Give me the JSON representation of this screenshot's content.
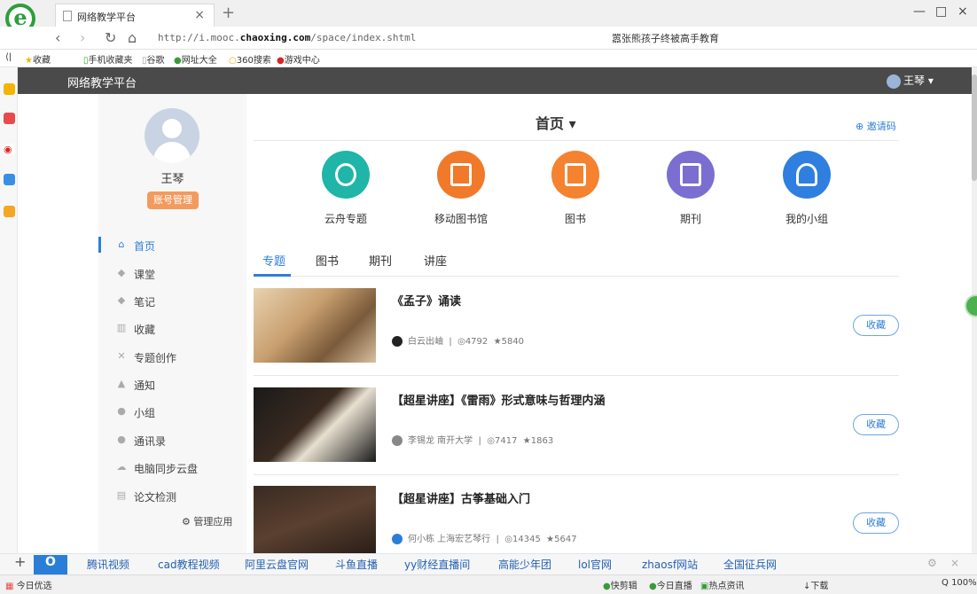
{
  "browser": {
    "tab_title": "网络教学平台",
    "tab_close": "×",
    "new_tab": "+",
    "url_prefix": "http://i.mooc.",
    "url_domain": "chaoxing.com",
    "url_path": "/space/index.shtml",
    "search_text": "嚣张熊孩子终被高手教育",
    "bookmarks": [
      "收藏",
      "手机收藏夹",
      "谷歌",
      "网址大全",
      "360搜索",
      "游戏中心"
    ],
    "win_controls": [
      "—",
      "□",
      "×"
    ]
  },
  "site": {
    "title": "网络教学平台",
    "user_name": "王琴",
    "page_title": "首页 ▾",
    "invite": "邀请码"
  },
  "profile": {
    "name": "王琴",
    "account_button": "账号管理"
  },
  "nav": [
    {
      "label": "首页",
      "icon": "home-icon",
      "glyph": "⌂"
    },
    {
      "label": "课堂",
      "icon": "classroom-icon",
      "glyph": "◆"
    },
    {
      "label": "笔记",
      "icon": "notes-icon",
      "glyph": "◆"
    },
    {
      "label": "收藏",
      "icon": "favorites-icon",
      "glyph": "▥"
    },
    {
      "label": "专题创作",
      "icon": "topic-create-icon",
      "glyph": "✕"
    },
    {
      "label": "通知",
      "icon": "bell-icon",
      "glyph": "▲"
    },
    {
      "label": "小组",
      "icon": "group-icon",
      "glyph": "●"
    },
    {
      "label": "通讯录",
      "icon": "contacts-icon",
      "glyph": "●"
    },
    {
      "label": "电脑同步云盘",
      "icon": "cloud-icon",
      "glyph": "☁"
    },
    {
      "label": "论文检测",
      "icon": "document-check-icon",
      "glyph": "▤"
    }
  ],
  "manage_apps": "管理应用",
  "features": [
    {
      "label": "云舟专题",
      "color": "#1fb5a8"
    },
    {
      "label": "移动图书馆",
      "color": "#f07a2a"
    },
    {
      "label": "图书",
      "color": "#f5822e"
    },
    {
      "label": "期刊",
      "color": "#7a6fd0"
    },
    {
      "label": "我的小组",
      "color": "#2f7fe0"
    }
  ],
  "tabs": [
    "专题",
    "图书",
    "期刊",
    "讲座"
  ],
  "cards": [
    {
      "title": "《孟子》诵读",
      "author": "白云出岫",
      "views": "4792",
      "stars": "5840",
      "fav": "收藏"
    },
    {
      "title": "【超星讲座】《雷雨》形式意味与哲理内涵",
      "author": "李锡龙 南开大学",
      "views": "7417",
      "stars": "1863",
      "fav": "收藏"
    },
    {
      "title": "【超星讲座】古筝基础入门",
      "author": "何小栋 上海宏艺琴行",
      "views": "14345",
      "stars": "5647",
      "fav": "收藏"
    }
  ],
  "bottom_links": [
    "腾讯视频",
    "cad教程视频",
    "阿里云盘官网",
    "斗鱼直播",
    "yy财经直播间",
    "高能少年团",
    "lol官网",
    "zhaosf网站",
    "全国征兵网"
  ],
  "status": {
    "left": "今日优选",
    "items": [
      "快剪辑",
      "今日直播",
      "热点资讯",
      "下载"
    ],
    "zoom": "100%"
  }
}
